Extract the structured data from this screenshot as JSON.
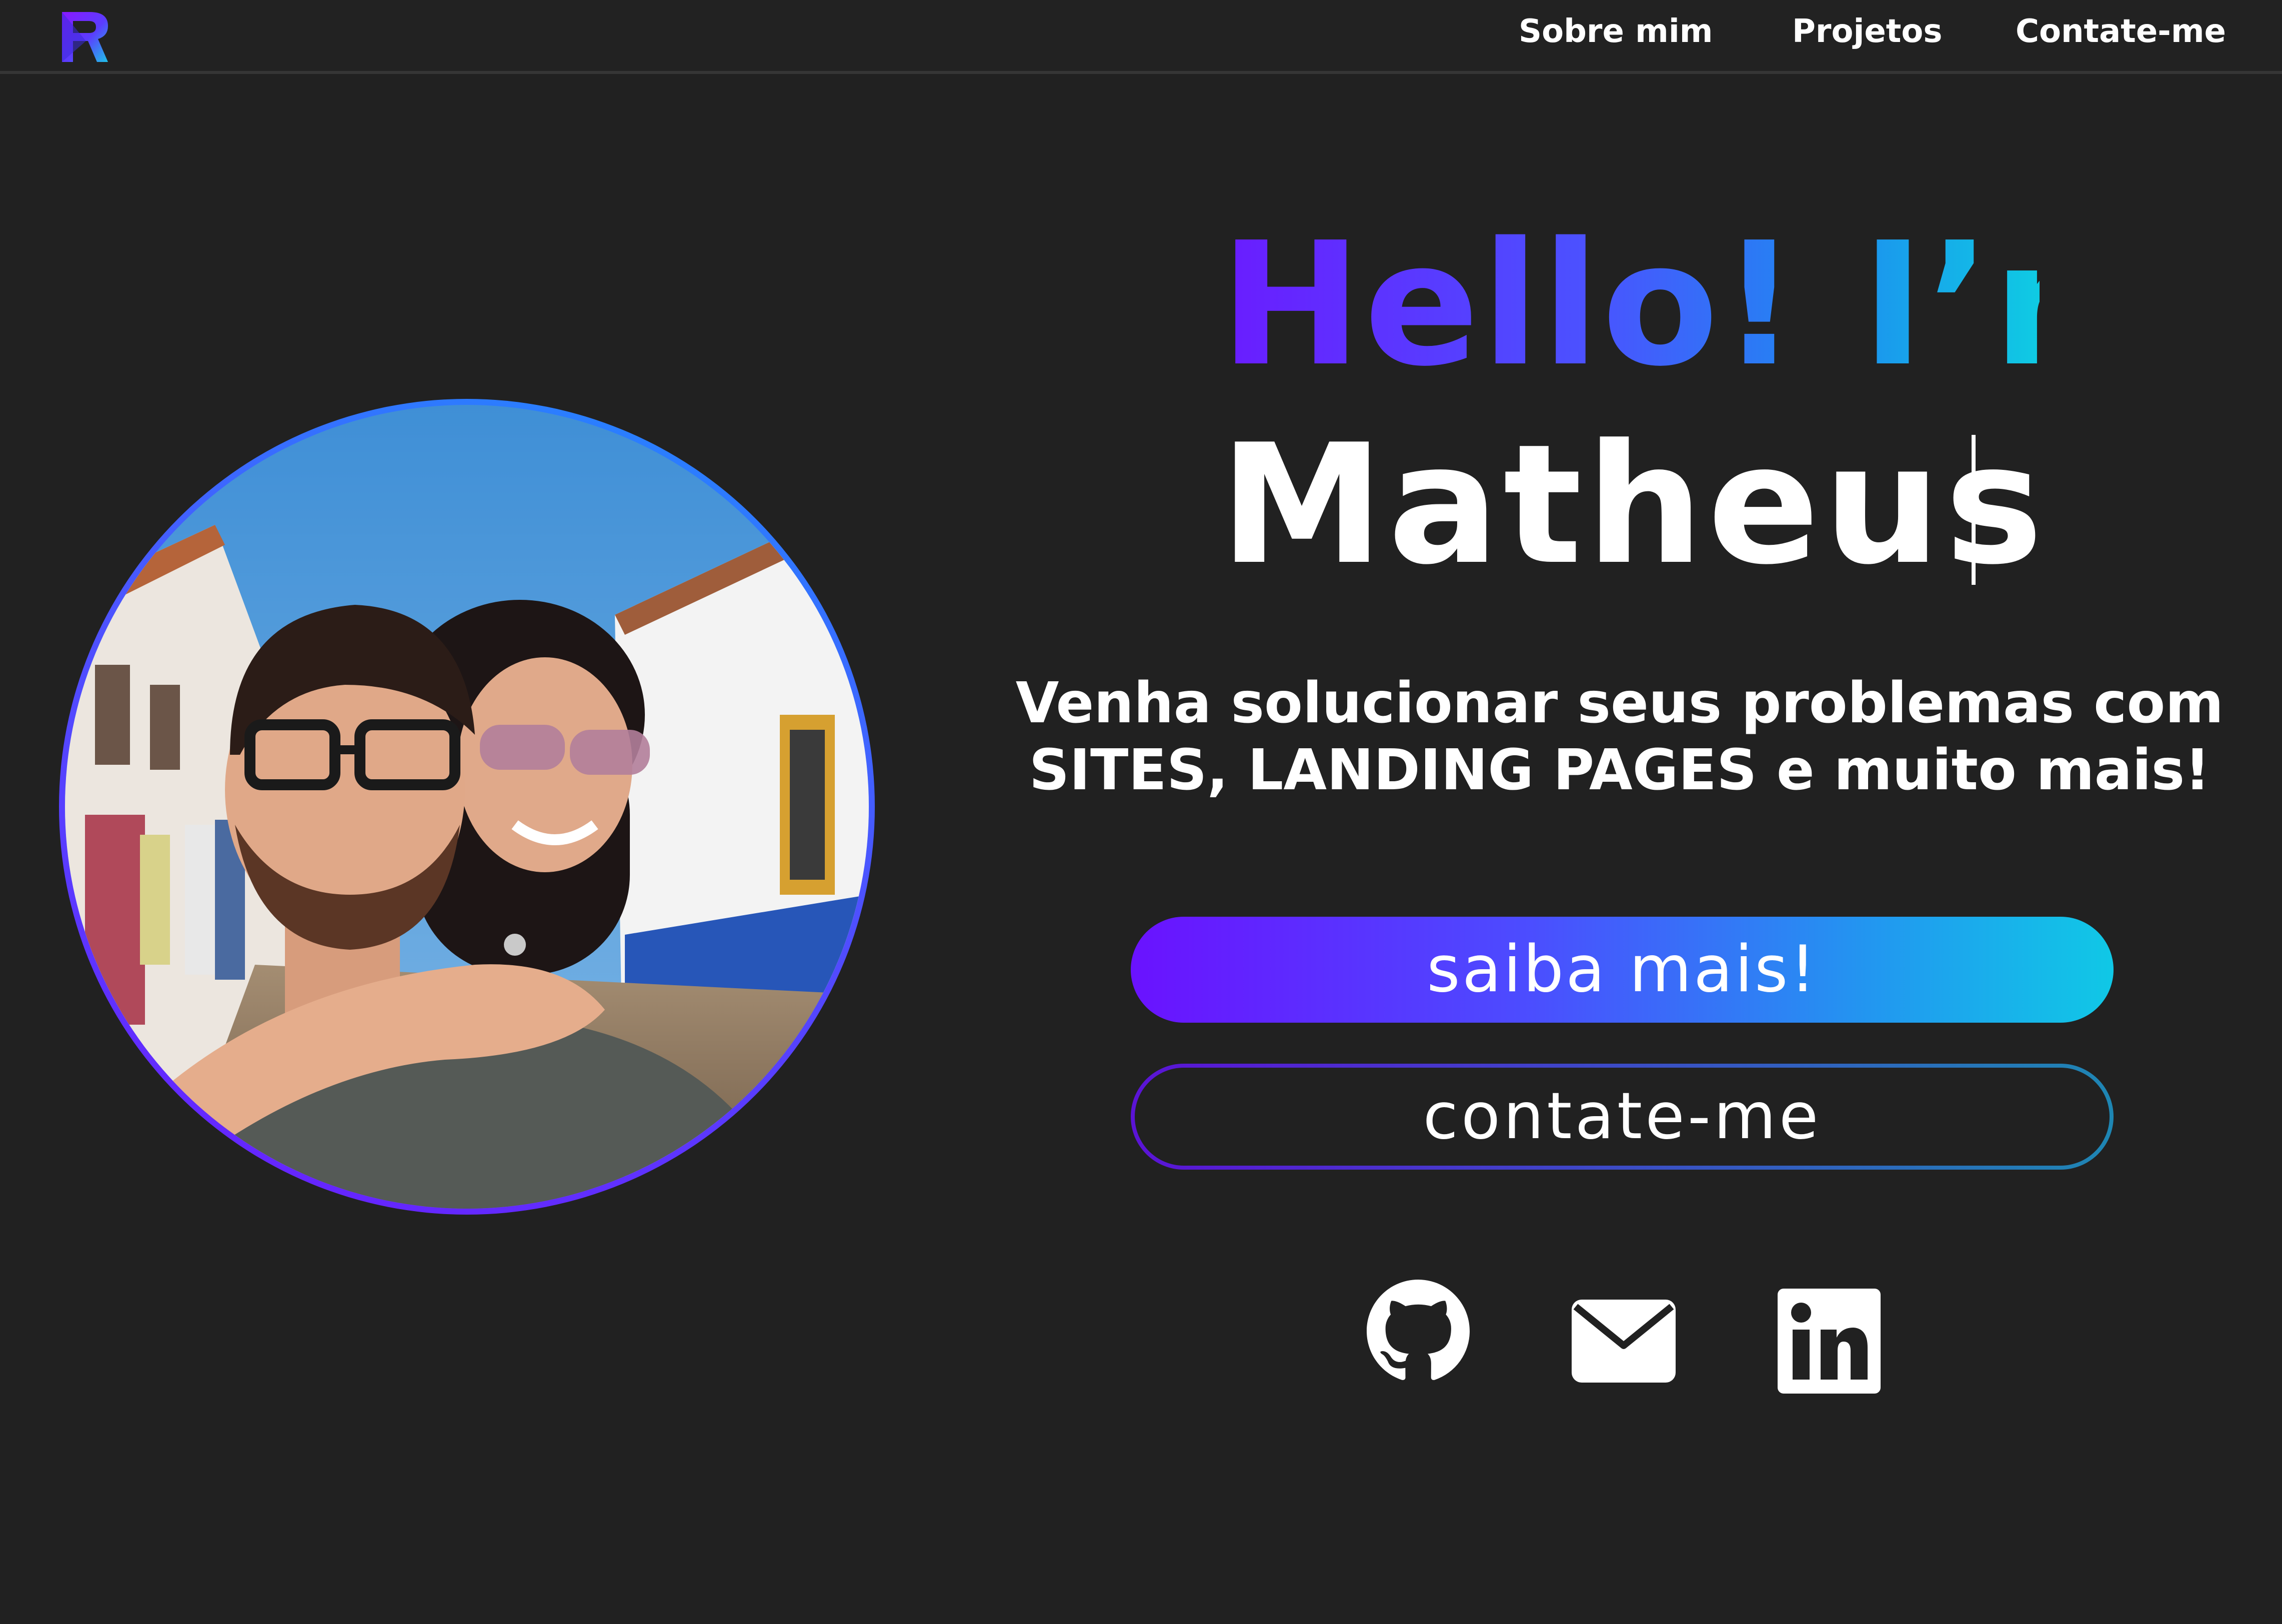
{
  "navbar": {
    "logo_icon": "brand-logo-icon",
    "links": [
      {
        "label": "Sobre mim"
      },
      {
        "label": "Projetos"
      },
      {
        "label": "Contate-me"
      }
    ]
  },
  "hero": {
    "greeting": "Hello! I’m",
    "name": "Matheus",
    "tagline_line1": "Venha solucionar seus problemas com",
    "tagline_line2": "SITES, LANDING PAGES e muito mais!",
    "primary_button": "saiba mais!",
    "secondary_button": "contate-me"
  },
  "photo": {
    "description_icon": "profile-photo"
  },
  "social": [
    {
      "icon": "github-icon"
    },
    {
      "icon": "mail-icon"
    },
    {
      "icon": "linkedin-icon"
    }
  ],
  "colors": {
    "background": "#212121",
    "navbar": "#222222",
    "gradient_start": "#6a12ff",
    "gradient_end": "#10c8e6",
    "text": "#ffffff"
  }
}
